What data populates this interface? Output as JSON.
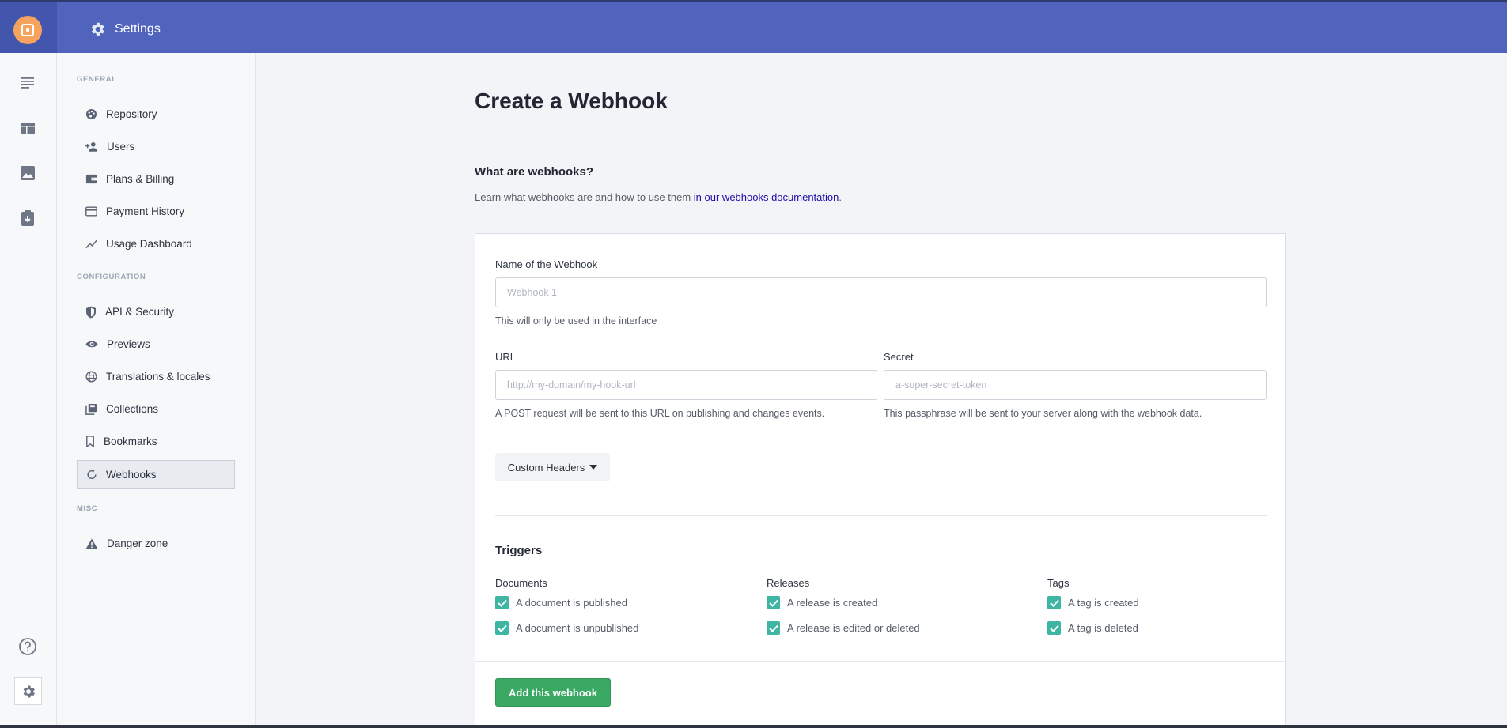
{
  "header": {
    "title": "Settings"
  },
  "sidebar": {
    "sections": [
      {
        "title": "GENERAL",
        "items": [
          {
            "label": "Repository",
            "icon": "palette-icon"
          },
          {
            "label": "Users",
            "icon": "add-user-icon"
          },
          {
            "label": "Plans & Billing",
            "icon": "wallet-icon"
          },
          {
            "label": "Payment History",
            "icon": "credit-card-icon"
          },
          {
            "label": "Usage Dashboard",
            "icon": "trend-chart-icon"
          }
        ]
      },
      {
        "title": "CONFIGURATION",
        "items": [
          {
            "label": "API & Security",
            "icon": "shield-icon"
          },
          {
            "label": "Previews",
            "icon": "eye-icon"
          },
          {
            "label": "Translations & locales",
            "icon": "globe-icon"
          },
          {
            "label": "Collections",
            "icon": "collections-icon"
          },
          {
            "label": "Bookmarks",
            "icon": "bookmark-icon"
          },
          {
            "label": "Webhooks",
            "icon": "sync-icon",
            "active": true
          }
        ]
      },
      {
        "title": "MISC",
        "items": [
          {
            "label": "Danger zone",
            "icon": "warning-icon"
          }
        ]
      }
    ]
  },
  "page": {
    "title": "Create a Webhook",
    "what_title": "What are webhooks?",
    "what_text": "Learn what webhooks are and how to use them ",
    "what_link": "in our webhooks documentation",
    "what_end": "."
  },
  "form": {
    "name_label": "Name of the Webhook",
    "name_placeholder": "Webhook 1",
    "name_help": "This will only be used in the interface",
    "url_label": "URL",
    "url_placeholder": "http://my-domain/my-hook-url",
    "url_help": "A POST request will be sent to this URL on publishing and changes events.",
    "secret_label": "Secret",
    "secret_placeholder": "a-super-secret-token",
    "secret_help": "This passphrase will be sent to your server along with the webhook data.",
    "custom_headers_label": "Custom Headers",
    "triggers_title": "Triggers",
    "groups": [
      {
        "title": "Documents",
        "items": [
          "A document is published",
          "A document is unpublished"
        ]
      },
      {
        "title": "Releases",
        "items": [
          "A release is created",
          "A release is edited or deleted"
        ]
      },
      {
        "title": "Tags",
        "items": [
          "A tag is created",
          "A tag is deleted"
        ]
      }
    ],
    "submit_label": "Add this webhook"
  },
  "colors": {
    "header": "#5063bd",
    "accent": "#3fb6a4",
    "submit": "#3aa963",
    "logo": "#f7a25d"
  }
}
